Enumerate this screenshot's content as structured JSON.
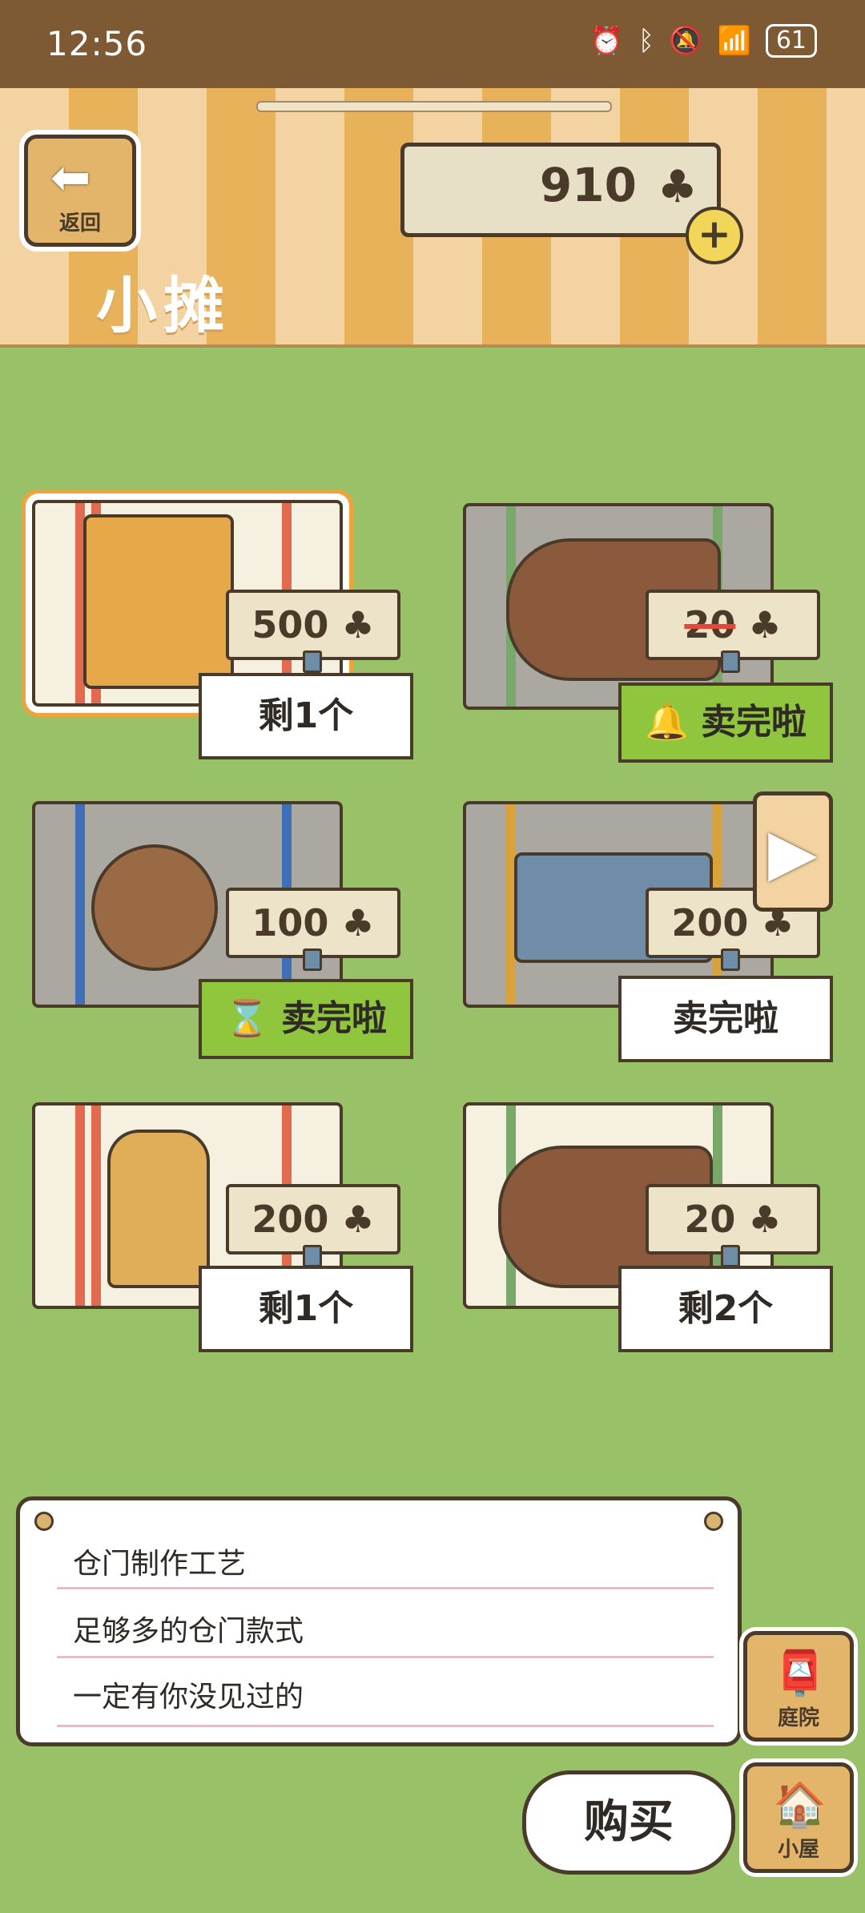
{
  "status_bar": {
    "time": "12:56",
    "battery": "61"
  },
  "header": {
    "back_label": "返回",
    "title": "小摊",
    "currency": "910",
    "currency_icon": "clover-icon"
  },
  "items": [
    {
      "price": "500",
      "stock": "剩1个",
      "sold_out": false
    },
    {
      "price": "20",
      "stock": "卖完啦",
      "sold_out": true,
      "price_struck": true
    },
    {
      "price": "100",
      "stock": "卖完啦",
      "sold_out": true
    },
    {
      "price": "200",
      "stock": "卖完啦",
      "sold_out": true
    },
    {
      "price": "200",
      "stock": "剩1个",
      "sold_out": false
    },
    {
      "price": "20",
      "stock": "剩2个",
      "sold_out": false
    }
  ],
  "description": {
    "line1": "仓门制作工艺",
    "line2": "足够多的仓门款式",
    "line3": "一定有你没见过的"
  },
  "side": {
    "yard_label": "庭院",
    "house_label": "小屋"
  },
  "buy_label": "购买",
  "colors": {
    "grass": "#98c168",
    "stripe_light": "#f3d3a2",
    "stripe_dark": "#e7b25a",
    "outline": "#4a3a2a",
    "sold_green": "#8fc63d"
  }
}
